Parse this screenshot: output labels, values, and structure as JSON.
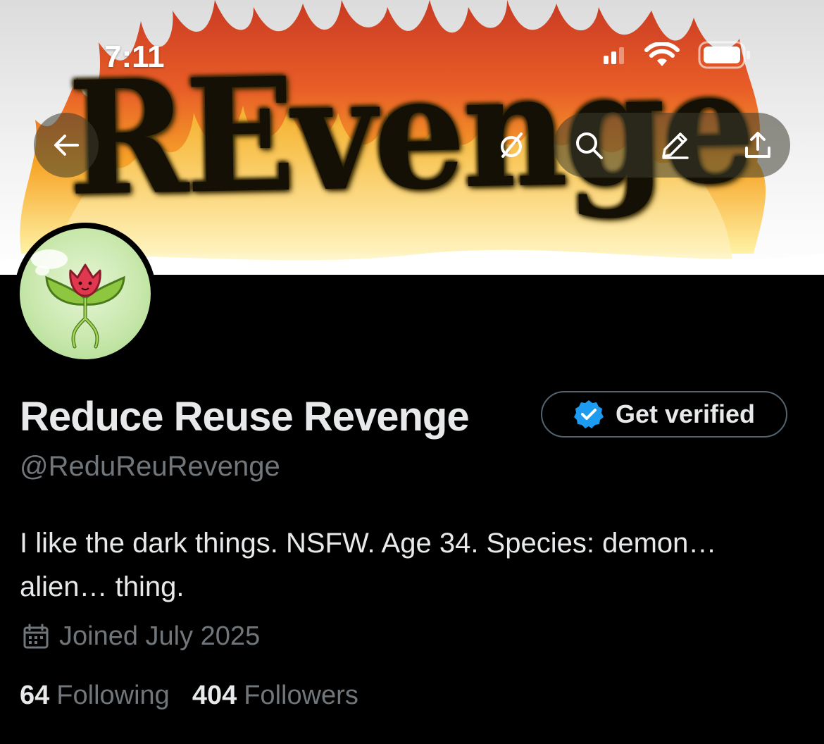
{
  "status_bar": {
    "time": "7:11"
  },
  "banner": {
    "text": "REvenge"
  },
  "nav": {
    "back_icon": "arrow-left-icon",
    "grok_icon": "slashed-circle-icon",
    "search_icon": "search-icon",
    "edit_icon": "pencil-icon",
    "share_icon": "share-upload-icon"
  },
  "profile": {
    "display_name": "Reduce Reuse Revenge",
    "verify_button_label": "Get verified",
    "handle": "@ReduReuRevenge",
    "bio": "I like the dark things. NSFW. Age 34. Species: demon… alien… thing.",
    "joined": "Joined July 2025",
    "following_count": "64",
    "following_label": "Following",
    "followers_count": "404",
    "followers_label": "Followers"
  },
  "colors": {
    "background": "#000000",
    "primary_text": "#e7e9ea",
    "secondary_text": "#71767b",
    "verified_blue": "#1d9bf0"
  }
}
